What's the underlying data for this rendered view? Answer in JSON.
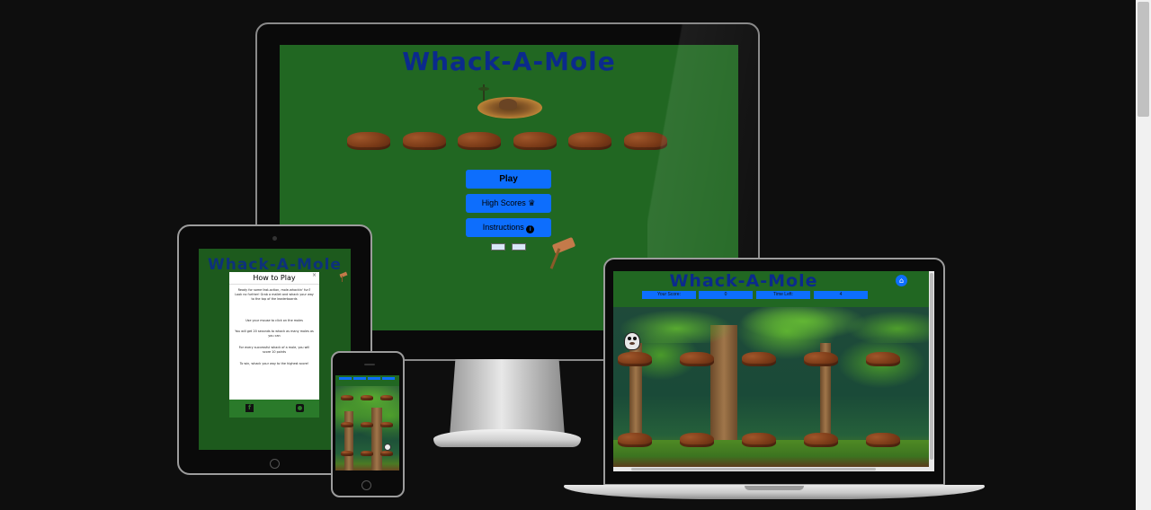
{
  "game": {
    "title": "Whack-A-Mole"
  },
  "monitor": {
    "buttons": {
      "play": "Play",
      "high_scores": "High Scores",
      "instructions": "Instructions"
    },
    "icons": {
      "high_scores": "crown-icon",
      "instructions": "info-icon"
    }
  },
  "tablet": {
    "modal": {
      "title": "How to Play",
      "close": "×",
      "intro": "Ready for some fast-action, mole-whackin' fun? Look no further! Grab a mallet and whack your way to the top of the leaderboards",
      "items": [
        "Use your mouse to click on the moles",
        "You will get 20 seconds to whack as many moles as you can",
        "For every successful whack of a mole, you will score 10 points",
        "To win, whack your way to the highest score!"
      ]
    }
  },
  "laptop": {
    "stats": {
      "score_label": "Your Score:",
      "score_value": "0",
      "time_label": "Time Left:",
      "time_value": "4"
    }
  },
  "colors": {
    "background": "#0e0e0e",
    "game_green": "#216722",
    "title_blue": "#0b2a8c",
    "button_blue": "#0d6efd"
  }
}
